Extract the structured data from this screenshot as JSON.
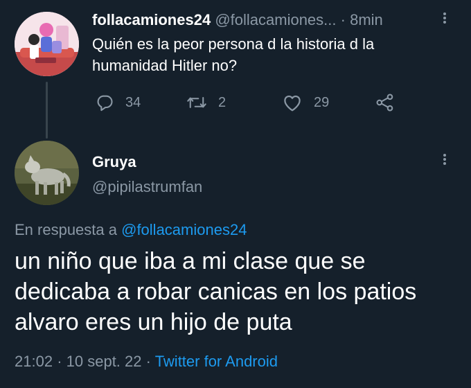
{
  "theme": {
    "background": "#15202b",
    "text": "#ffffff",
    "muted": "#8b98a5",
    "link": "#1d9bf0",
    "thread_line": "#38444d"
  },
  "parent_tweet": {
    "avatar_icon": "profile-illustration-avatar",
    "display_name": "follacamiones24",
    "handle": "@follacamiones...",
    "separator": "·",
    "time": "8min",
    "text": "Quién es la peor persona d la historia d la humanidad Hitler no?",
    "actions": {
      "reply": {
        "icon": "reply-icon",
        "count": "34"
      },
      "retweet": {
        "icon": "retweet-icon",
        "count": "2"
      },
      "like": {
        "icon": "heart-icon",
        "count": "29"
      },
      "share": {
        "icon": "share-icon"
      }
    }
  },
  "reply_tweet": {
    "avatar_icon": "wolf-photo-avatar",
    "display_name": "Gruya",
    "handle": "@pipilastrumfan",
    "reply_prefix": "En respuesta a",
    "reply_target": "@follacamiones24",
    "text": "un niño que iba a mi clase que se dedicaba a robar canicas en los patios alvaro eres un hijo de puta",
    "time": "21:02",
    "date": "10 sept. 22",
    "separator": "·",
    "source": "Twitter for Android"
  }
}
